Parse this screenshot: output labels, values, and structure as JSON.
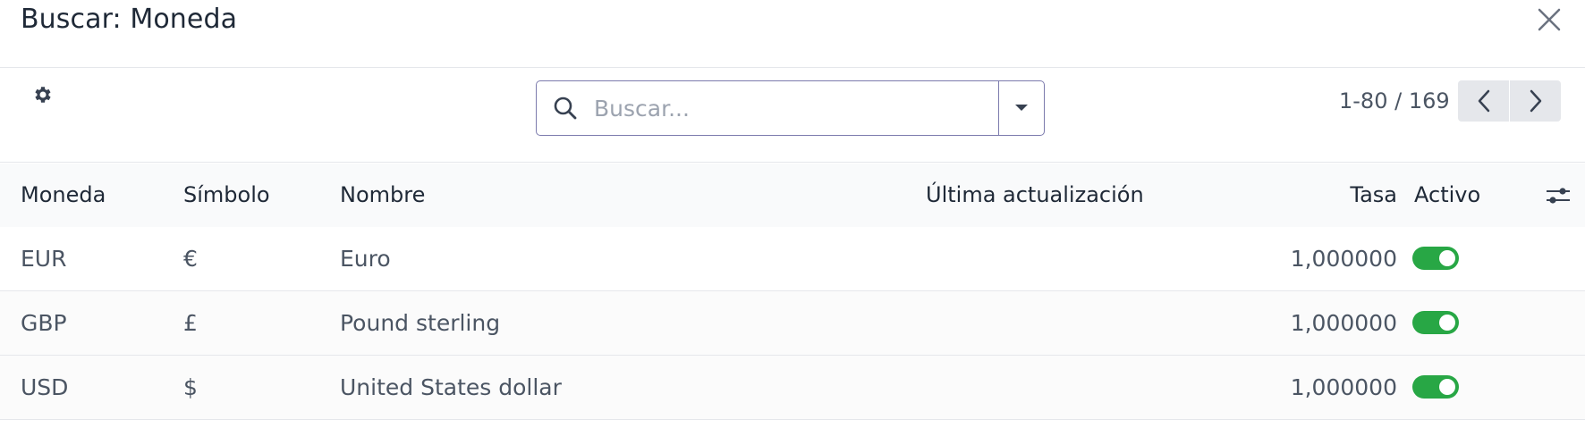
{
  "dialog": {
    "title": "Buscar: Moneda"
  },
  "controls": {
    "search": {
      "placeholder": "Buscar...",
      "value": ""
    },
    "pager": {
      "value": "1-80 / 169"
    }
  },
  "table": {
    "columns": {
      "currency": "Moneda",
      "symbol": "Símbolo",
      "name": "Nombre",
      "last_update": "Última actualización",
      "rate": "Tasa",
      "active": "Activo"
    },
    "rows": [
      {
        "currency": "EUR",
        "symbol": "€",
        "name": "Euro",
        "last_update": "",
        "rate": "1,000000",
        "active": true
      },
      {
        "currency": "GBP",
        "symbol": "£",
        "name": "Pound sterling",
        "last_update": "",
        "rate": "1,000000",
        "active": true
      },
      {
        "currency": "USD",
        "symbol": "$",
        "name": "United States dollar",
        "last_update": "",
        "rate": "1,000000",
        "active": true
      }
    ]
  },
  "icons": {
    "close": "close-icon",
    "settings": "gear-icon",
    "search": "search-icon",
    "toggle_filters": "caret-down-icon",
    "prev": "chevron-left-icon",
    "next": "chevron-right-icon",
    "optional_columns": "sliders-icon"
  },
  "colors": {
    "toggle_on": "#28a745",
    "search_border": "#7c7bad",
    "pager_button": "#e5e7eb"
  }
}
